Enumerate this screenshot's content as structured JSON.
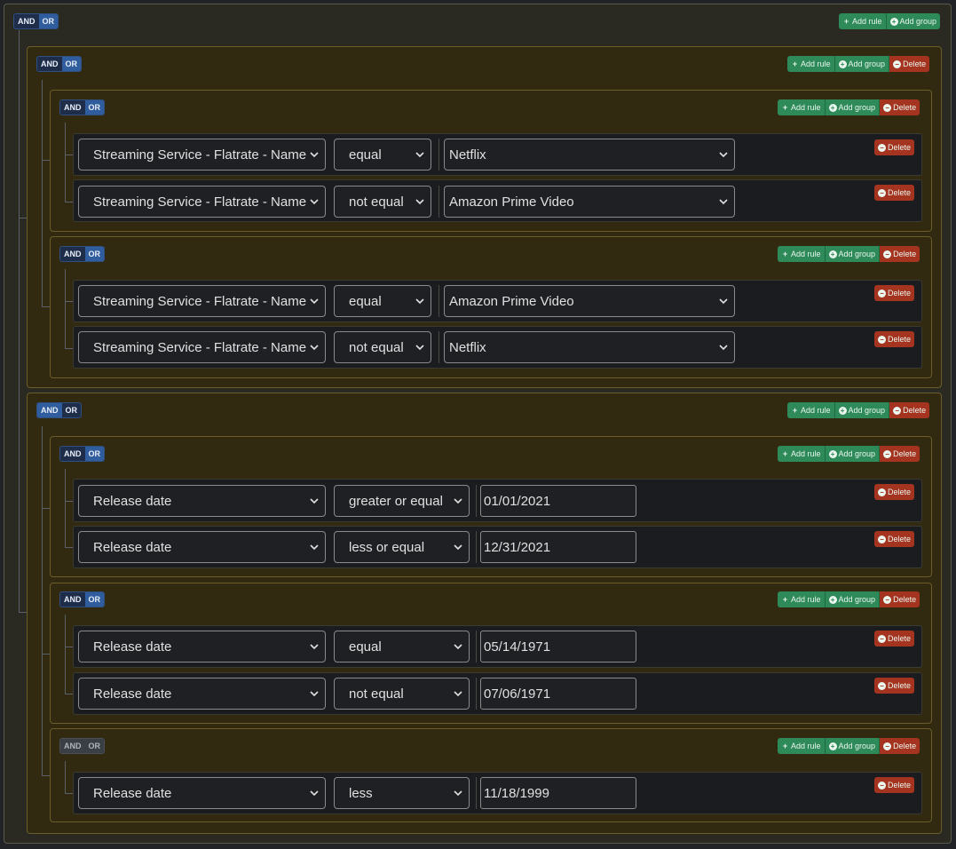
{
  "labels": {
    "and": "AND",
    "or": "OR",
    "add_rule": "Add rule",
    "add_group": "Add group",
    "delete": "Delete"
  },
  "icons": {
    "add_rule": "plus-icon",
    "add_group": "plus-circle-icon",
    "delete": "minus-circle-icon",
    "select": "chevron-down-icon"
  },
  "colors": {
    "group_bg": "#322911",
    "add_button": "#2e8a59",
    "delete_button": "#a4331f",
    "active_condition": "#2f5d9e"
  },
  "root": {
    "condition": "OR"
  },
  "groups": [
    {
      "condition": "OR",
      "subgroups": [
        {
          "condition": "OR",
          "rules": [
            {
              "field": "Streaming Service - Flatrate - Name",
              "operator": "equal",
              "value": "Netflix"
            },
            {
              "field": "Streaming Service - Flatrate - Name",
              "operator": "not equal",
              "value": "Amazon Prime Video"
            }
          ]
        },
        {
          "condition": "OR",
          "rules": [
            {
              "field": "Streaming Service - Flatrate - Name",
              "operator": "equal",
              "value": "Amazon Prime Video"
            },
            {
              "field": "Streaming Service - Flatrate - Name",
              "operator": "not equal",
              "value": "Netflix"
            }
          ]
        }
      ]
    },
    {
      "condition": "AND",
      "subgroups": [
        {
          "condition": "OR",
          "rules": [
            {
              "field": "Release date",
              "operator": "greater or equal",
              "value": "01/01/2021"
            },
            {
              "field": "Release date",
              "operator": "less or equal",
              "value": "12/31/2021"
            }
          ]
        },
        {
          "condition": "OR",
          "rules": [
            {
              "field": "Release date",
              "operator": "equal",
              "value": "05/14/1971"
            },
            {
              "field": "Release date",
              "operator": "not equal",
              "value": "07/06/1971"
            }
          ]
        },
        {
          "condition": "AND",
          "rules": [
            {
              "field": "Release date",
              "operator": "less",
              "value": "11/18/1999"
            }
          ]
        }
      ]
    }
  ]
}
